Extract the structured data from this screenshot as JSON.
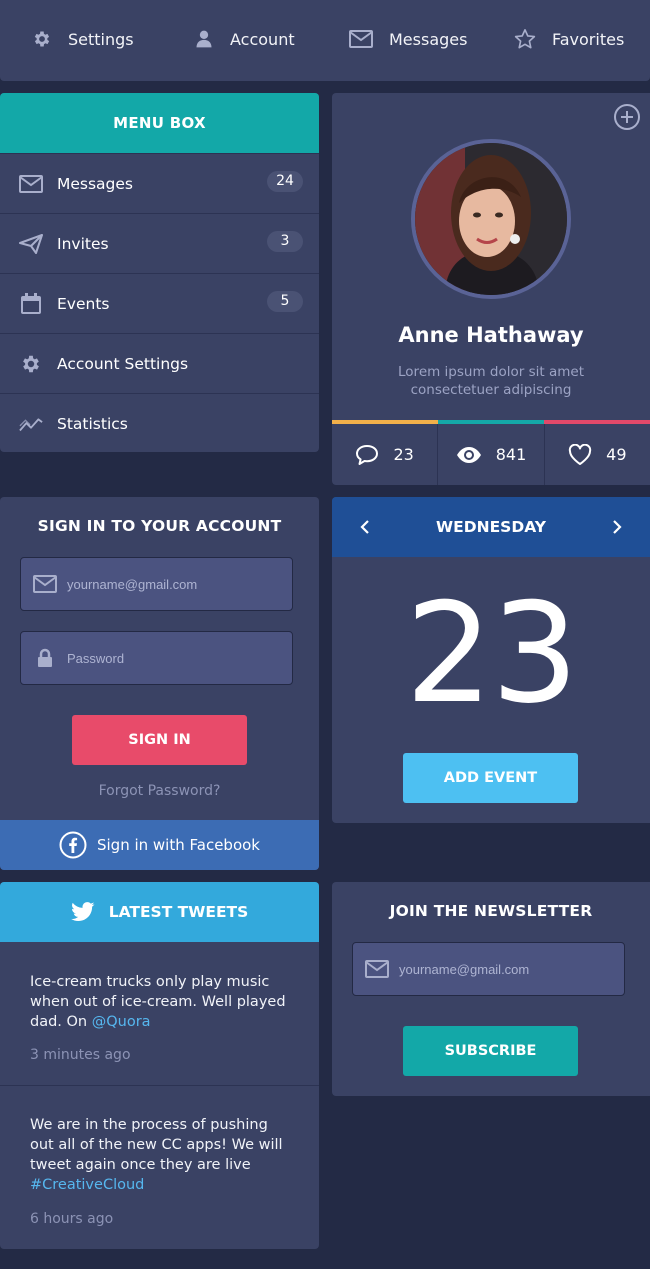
{
  "topnav": {
    "items": [
      {
        "label": "Settings",
        "icon": "gear-icon"
      },
      {
        "label": "Account",
        "icon": "user-icon"
      },
      {
        "label": "Messages",
        "icon": "envelope-icon"
      },
      {
        "label": "Favorites",
        "icon": "star-icon"
      }
    ]
  },
  "menu": {
    "title": "MENU BOX",
    "items": [
      {
        "label": "Messages",
        "icon": "envelope-icon",
        "badge": "24"
      },
      {
        "label": "Invites",
        "icon": "paper-plane-icon",
        "badge": "3"
      },
      {
        "label": "Events",
        "icon": "calendar-icon",
        "badge": "5"
      },
      {
        "label": "Account Settings",
        "icon": "gear-icon"
      },
      {
        "label": "Statistics",
        "icon": "chart-line-icon"
      }
    ]
  },
  "profile": {
    "name": "Anne Hathaway",
    "bio": "Lorem ipsum dolor sit amet consectetuer adipiscing",
    "stats": [
      {
        "icon": "comment-icon",
        "value": "23"
      },
      {
        "icon": "eye-icon",
        "value": "841"
      },
      {
        "icon": "heart-icon",
        "value": "49"
      }
    ],
    "bar_colors": [
      "#f2b04a",
      "#15a8a8",
      "#e2496a"
    ]
  },
  "signin": {
    "title": "SIGN IN TO YOUR ACCOUNT",
    "email_placeholder": "yourname@gmail.com",
    "password_placeholder": "Password",
    "button": "SIGN IN",
    "forgot": "Forgot Password?",
    "facebook": "Sign in with Facebook"
  },
  "calendar": {
    "day": "WEDNESDAY",
    "date": "23",
    "button": "ADD EVENT"
  },
  "tweets": {
    "title": "LATEST TWEETS",
    "items": [
      {
        "text": "Ice-cream trucks only play music when out of ice-cream. Well played dad. On",
        "link": "@Quora",
        "time": "3 minutes ago"
      },
      {
        "text": "We are in the process of pushing out all of the new CC apps! We will tweet again once they are live",
        "link": "#CreativeCloud",
        "time": "6 hours ago"
      }
    ]
  },
  "newsletter": {
    "title": "JOIN THE NEWSLETTER",
    "email_placeholder": "yourname@gmail.com",
    "button": "SUBSCRIBE"
  },
  "colors": {
    "background": "#232a45",
    "card": "#3a4264",
    "teal": "#13a8a8",
    "red": "#e84b6a",
    "sky": "#4dc0f2",
    "calendar_header": "#1f4f96",
    "facebook": "#3c6cb4",
    "twitter": "#33a9dc"
  }
}
